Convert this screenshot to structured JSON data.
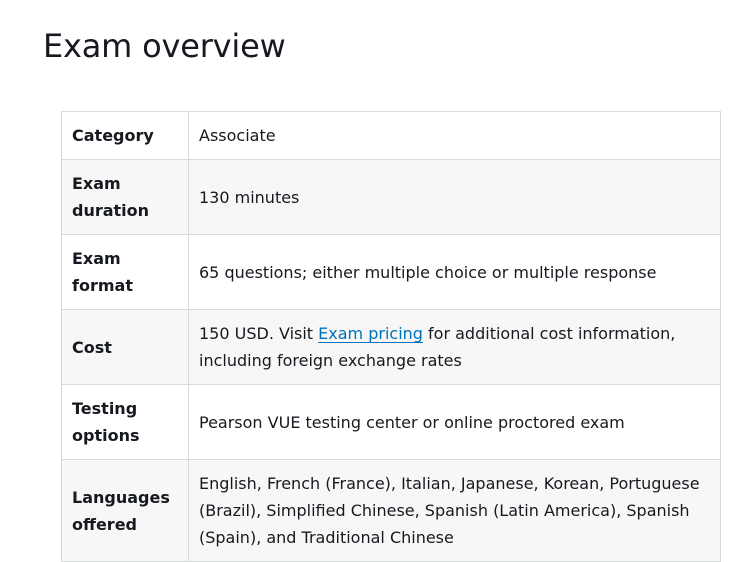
{
  "page": {
    "title": "Exam overview"
  },
  "table": {
    "rows": [
      {
        "label": "Category",
        "value": "Associate"
      },
      {
        "label": "Exam duration",
        "value": "130 minutes"
      },
      {
        "label": "Exam format",
        "value": "65 questions; either multiple choice or multiple response"
      },
      {
        "label": "Cost",
        "value_prefix": "150 USD. Visit ",
        "link_text": "Exam pricing",
        "value_suffix": " for additional cost information, including foreign exchange rates"
      },
      {
        "label": "Testing options",
        "value": "Pearson VUE testing center or online proctored exam"
      },
      {
        "label": "Languages offered",
        "value": "English, French (France), Italian, Japanese, Korean, Portuguese (Brazil), Simplified Chinese, Spanish (Latin America), Spanish (Spain), and Traditional Chinese"
      }
    ]
  },
  "colors": {
    "text": "#16191f",
    "link": "#0073bb",
    "border": "#d5dbdb",
    "stripe": "#f7f7f7"
  }
}
